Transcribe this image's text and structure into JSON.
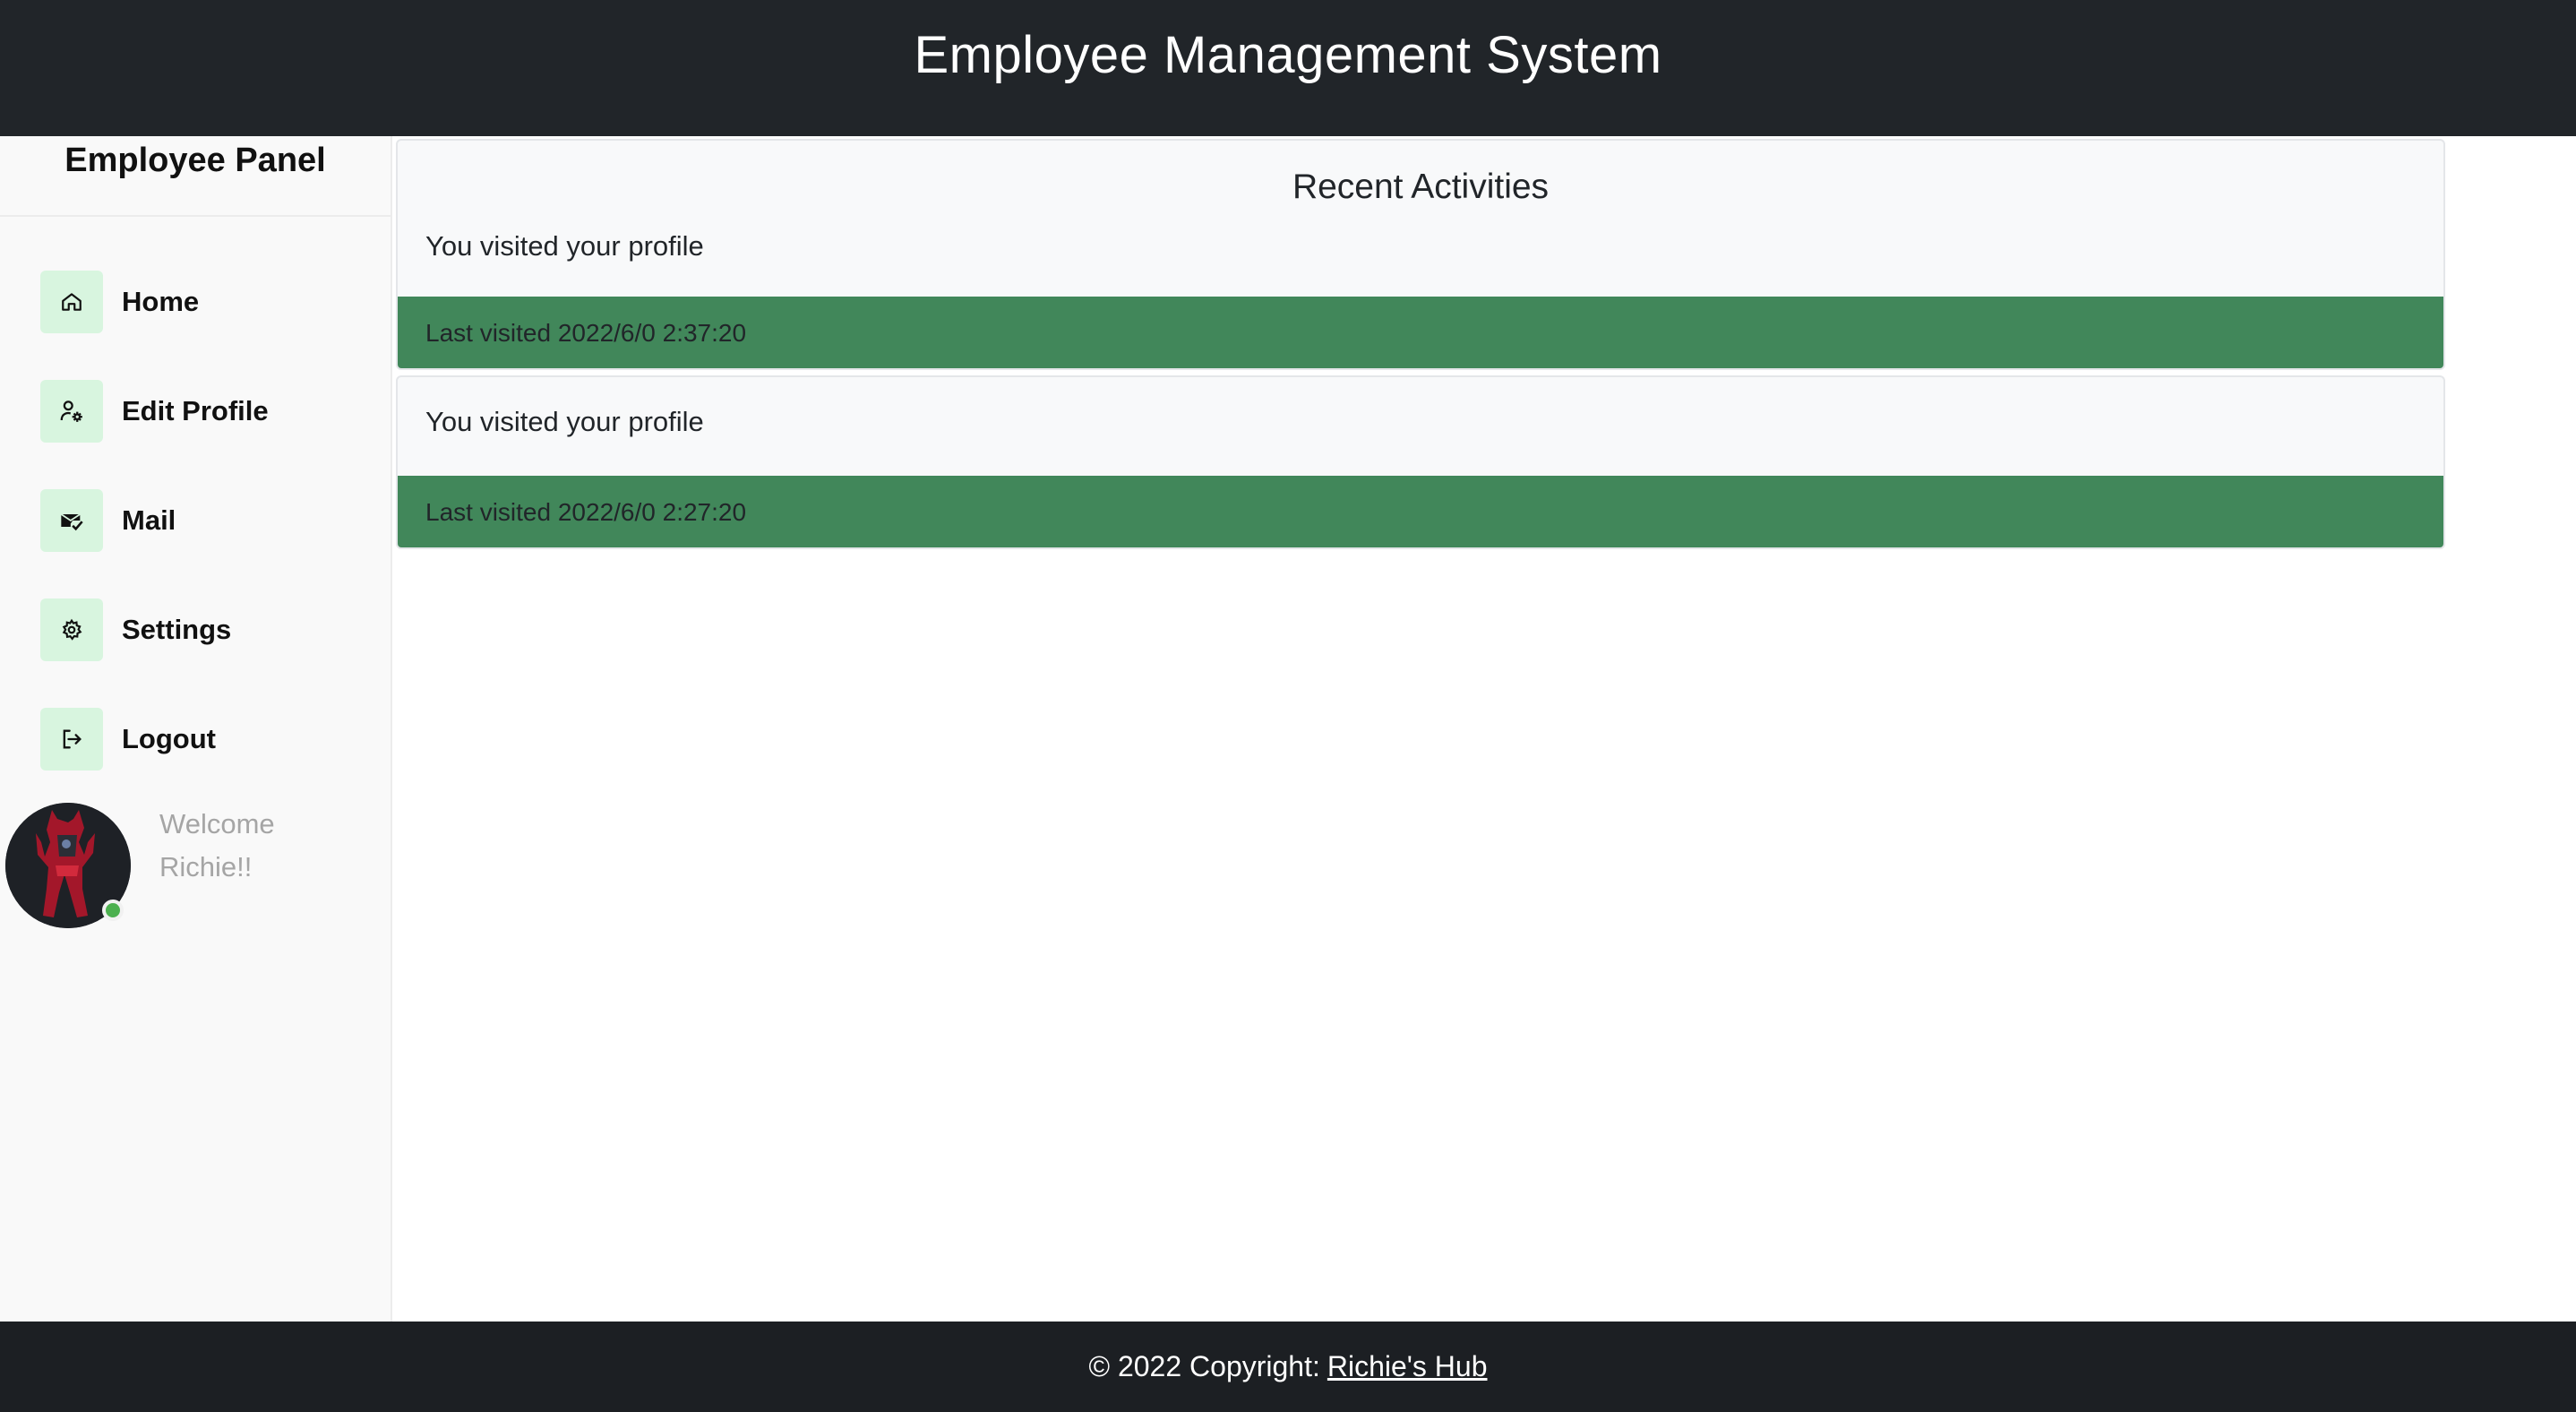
{
  "header": {
    "title": "Employee Management System"
  },
  "sidebar": {
    "title": "Employee Panel",
    "items": [
      {
        "label": "Home",
        "icon": "home-icon"
      },
      {
        "label": "Edit Profile",
        "icon": "user-gear-icon"
      },
      {
        "label": "Mail",
        "icon": "mail-check-icon"
      },
      {
        "label": "Settings",
        "icon": "gear-icon"
      },
      {
        "label": "Logout",
        "icon": "logout-icon"
      }
    ],
    "user": {
      "welcome_line1": "Welcome",
      "welcome_line2": "Richie!!"
    }
  },
  "main": {
    "section_title": "Recent Activities",
    "activities": [
      {
        "text": "You visited your profile",
        "footer": "Last visited 2022/6/0 2:37:20"
      },
      {
        "text": "You visited your profile",
        "footer": "Last visited 2022/6/0 2:27:20"
      }
    ]
  },
  "footer": {
    "copyright": "© 2022 Copyright:",
    "link": "Richie's Hub"
  },
  "colors": {
    "header_bg": "#212529",
    "footer_bg": "#1c1f23",
    "accent_green": "#41875a",
    "icon_bg": "#d8f5df",
    "status_online": "#4cb04f"
  }
}
